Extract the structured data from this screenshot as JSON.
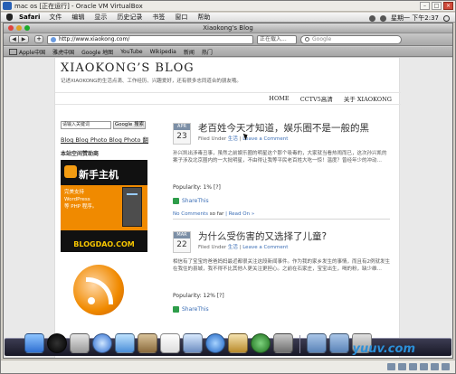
{
  "vbox": {
    "title": "mac os [正在运行] - Oracle VM VirtualBox",
    "watermark": "yuuv.com"
  },
  "menubar": {
    "app": "Safari",
    "items": [
      "文件",
      "编辑",
      "显示",
      "历史记录",
      "书签",
      "窗口",
      "帮助"
    ],
    "clock": "星期一 下午2:37"
  },
  "safari": {
    "title": "Xiaokong's Blog",
    "url": "http://www.xiaokong.com/",
    "loading": "正在载入...",
    "search_placeholder": "Google",
    "bookmarks": [
      "Apple中国",
      "雅虎中国",
      "Google 地图",
      "YouTube",
      "Wikipedia",
      "新闻",
      "热门"
    ]
  },
  "blog": {
    "title": "XIAOKONG’S BLOG",
    "description": "记述XIAOKONG的生活点滴、工作经历、兴趣爱好，还有很多志同道合的朋友哦。",
    "nav": [
      "HOME",
      "CCTV5高清",
      "关于 XIAOKONG"
    ]
  },
  "sidebar": {
    "search_placeholder": "请输入关键词",
    "search_button": "Google 搜索",
    "links": "Blog Blog Photo Blog Photo 翻",
    "heading": "本站空间赞助商",
    "ad_title": "新手主机",
    "ad_lines": [
      "完美支持",
      "WordPress",
      "等 PHP 程序。"
    ],
    "ad_url": "BLOGDAO.COM"
  },
  "posts": [
    {
      "month": "APR",
      "day": "23",
      "title": "老百姓今天才知道，娱乐圈不是一般的黑",
      "filed_under": "Filed Under",
      "category": "生活",
      "comment_link": "Leave a Comment",
      "excerpt": "孙兴凯出涉毒丑事，虽然之前娱乐圈的明星这个那个吸毒的，大家就当看热闹而已，这次孙兴凯的案子涉及北京圈内的一大批明星，不由得让我等平民老百姓大吃一惊！温度？曾经年少的冲动…",
      "popularity": "Popularity: 1% [?]",
      "share": "ShareThis",
      "comments_link": "No Comments",
      "comments_suffix": "so far",
      "read_on": "Read On »"
    },
    {
      "month": "MAR",
      "day": "22",
      "title": "为什么受伤害的又选择了儿童?",
      "filed_under": "Filed Under",
      "category": "生活",
      "comment_link": "Leave a Comment",
      "excerpt": "相信有了宝宝的爸爸妈妈最近都很关注这段新闻事件。作为我的家乡发生的事情，而且有2例就发生在我住的县城，我不得不比其他人更关注更担心。之前在石家庄，宝宝出生，喝的粉，缺少维…",
      "popularity": "Popularity: 12% [?]",
      "share": "ShareThis",
      "comments_link": "",
      "comments_suffix": "",
      "read_on": ""
    }
  ],
  "colors": {
    "link": "#3a6db5",
    "dock": "#1f1f2e",
    "ad_orange": "#f08a00"
  },
  "dock_icons": [
    "finder-icon",
    "dashboard-icon",
    "mail-icon",
    "safari-icon",
    "ichat-icon",
    "addressbook-icon",
    "ical-icon",
    "preview-icon",
    "itunes-icon",
    "iphoto-icon",
    "timemachine-icon",
    "systemprefs-icon",
    "folder-icon",
    "documents-icon",
    "trash-icon"
  ]
}
